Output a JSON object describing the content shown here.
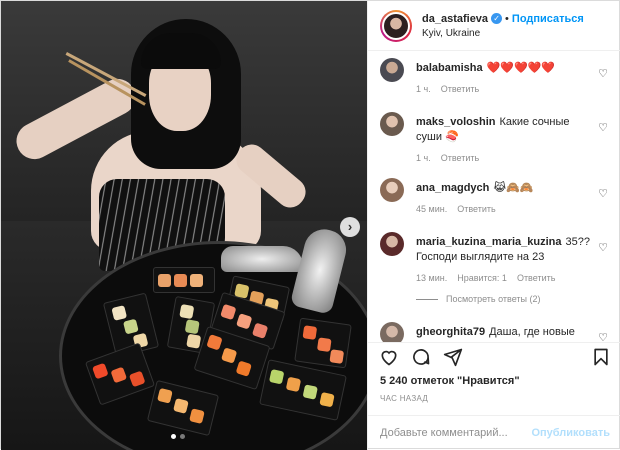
{
  "header": {
    "username": "da_astafieva",
    "verified_icon": "verified-badge-icon",
    "separator": "•",
    "follow_label": "Подписаться",
    "location": "Kyiv, Ukraine"
  },
  "comments": [
    {
      "user": "balabamisha",
      "text": "❤️❤️❤️❤️❤️",
      "time": "1 ч.",
      "reply": "Ответить",
      "likes": ""
    },
    {
      "user": "maks_voloshin",
      "text": "Какие сочные суши 🍣",
      "time": "1 ч.",
      "reply": "Ответить",
      "likes": ""
    },
    {
      "user": "ana_magdych",
      "text": "😹🙈🙈",
      "time": "45 мин.",
      "reply": "Ответить",
      "likes": ""
    },
    {
      "user": "maria_kuzina_maria_kuzina",
      "text": "35?? Господи выглядите на 23",
      "time": "13 мин.",
      "likes": "Нравится: 1",
      "reply": "Ответить"
    },
    {
      "user": "gheorghita79",
      "text": "Даша, где новые",
      "time": "",
      "reply": "",
      "likes": ""
    }
  ],
  "view_replies": "Посмотреть ответы (2)",
  "actions": {
    "like_icon": "heart-outline-icon",
    "comment_icon": "comment-icon",
    "share_icon": "paper-plane-icon",
    "save_icon": "bookmark-icon"
  },
  "likes_text": "5 240 отметок \"Нравится\"",
  "timestamp": "ЧАС НАЗАД",
  "comment_box": {
    "placeholder": "Добавьте комментарий...",
    "publish_label": "Опубликовать"
  },
  "carousel": {
    "next_icon": "chevron-right-icon",
    "total_slides": 2,
    "active_slide": 1
  }
}
